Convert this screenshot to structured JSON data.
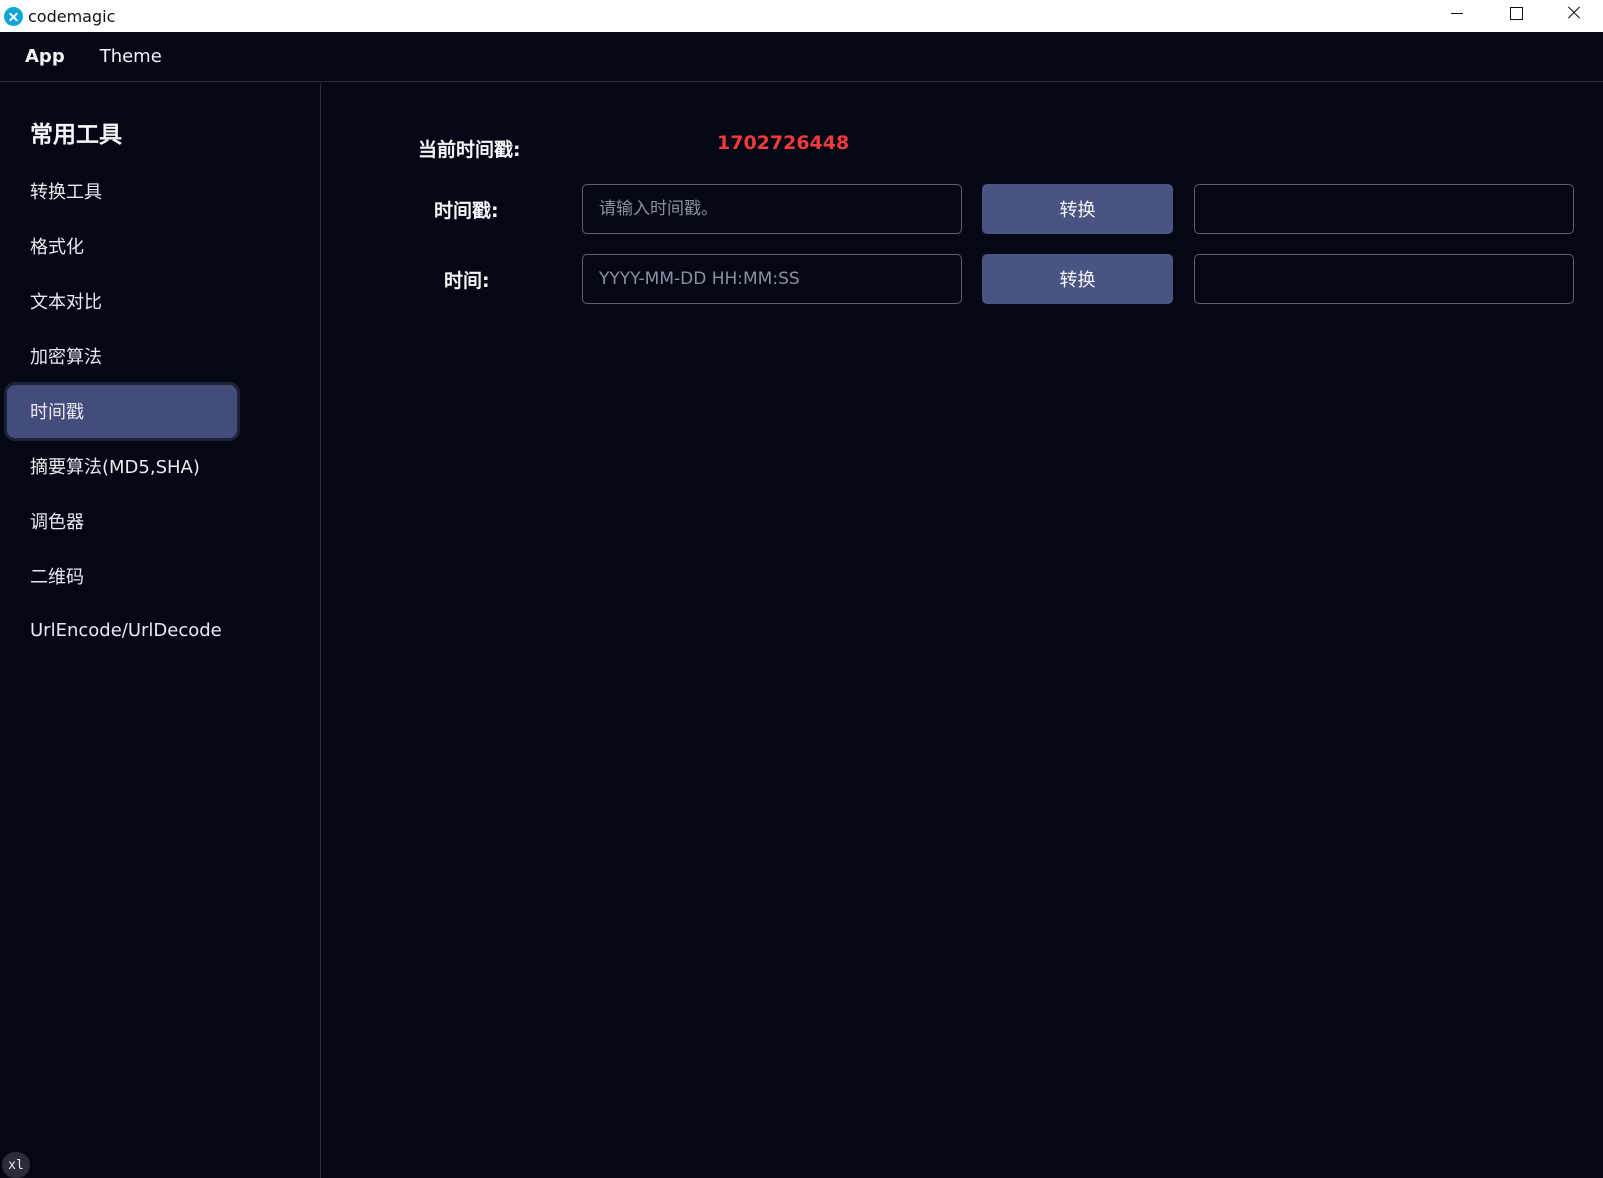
{
  "window": {
    "title": "codemagic",
    "app_icon": "codemagic-logo-icon",
    "controls": [
      "minimize-icon",
      "maximize-icon",
      "close-icon"
    ]
  },
  "menubar": {
    "items": [
      {
        "label": "App"
      },
      {
        "label": "Theme"
      }
    ]
  },
  "sidebar": {
    "title": "常用工具",
    "items": [
      {
        "label": "转换工具",
        "active": false
      },
      {
        "label": "格式化",
        "active": false
      },
      {
        "label": "文本对比",
        "active": false
      },
      {
        "label": "加密算法",
        "active": false
      },
      {
        "label": "时间戳",
        "active": true
      },
      {
        "label": "摘要算法(MD5,SHA)",
        "active": false
      },
      {
        "label": "调色器",
        "active": false
      },
      {
        "label": "二维码",
        "active": false
      },
      {
        "label": "UrlEncode/UrlDecode",
        "active": false
      }
    ]
  },
  "main": {
    "current_label": "当前时间戳:",
    "current_value": "1702726448",
    "timestamp_row": {
      "label": "时间戳:",
      "input_value": "",
      "input_placeholder": "请输入时间戳。",
      "button_label": "转换",
      "output_value": ""
    },
    "datetime_row": {
      "label": "时间:",
      "input_value": "",
      "input_placeholder": "YYYY-MM-DD HH:MM:SS",
      "button_label": "转换",
      "output_value": ""
    }
  },
  "badge": {
    "label": "xl"
  },
  "colors": {
    "background": "#040814",
    "accent": "#4a5482",
    "active_nav": "#434c7b",
    "timestamp_value": "#ef3b3b",
    "app_icon": "#0ea5d8"
  }
}
